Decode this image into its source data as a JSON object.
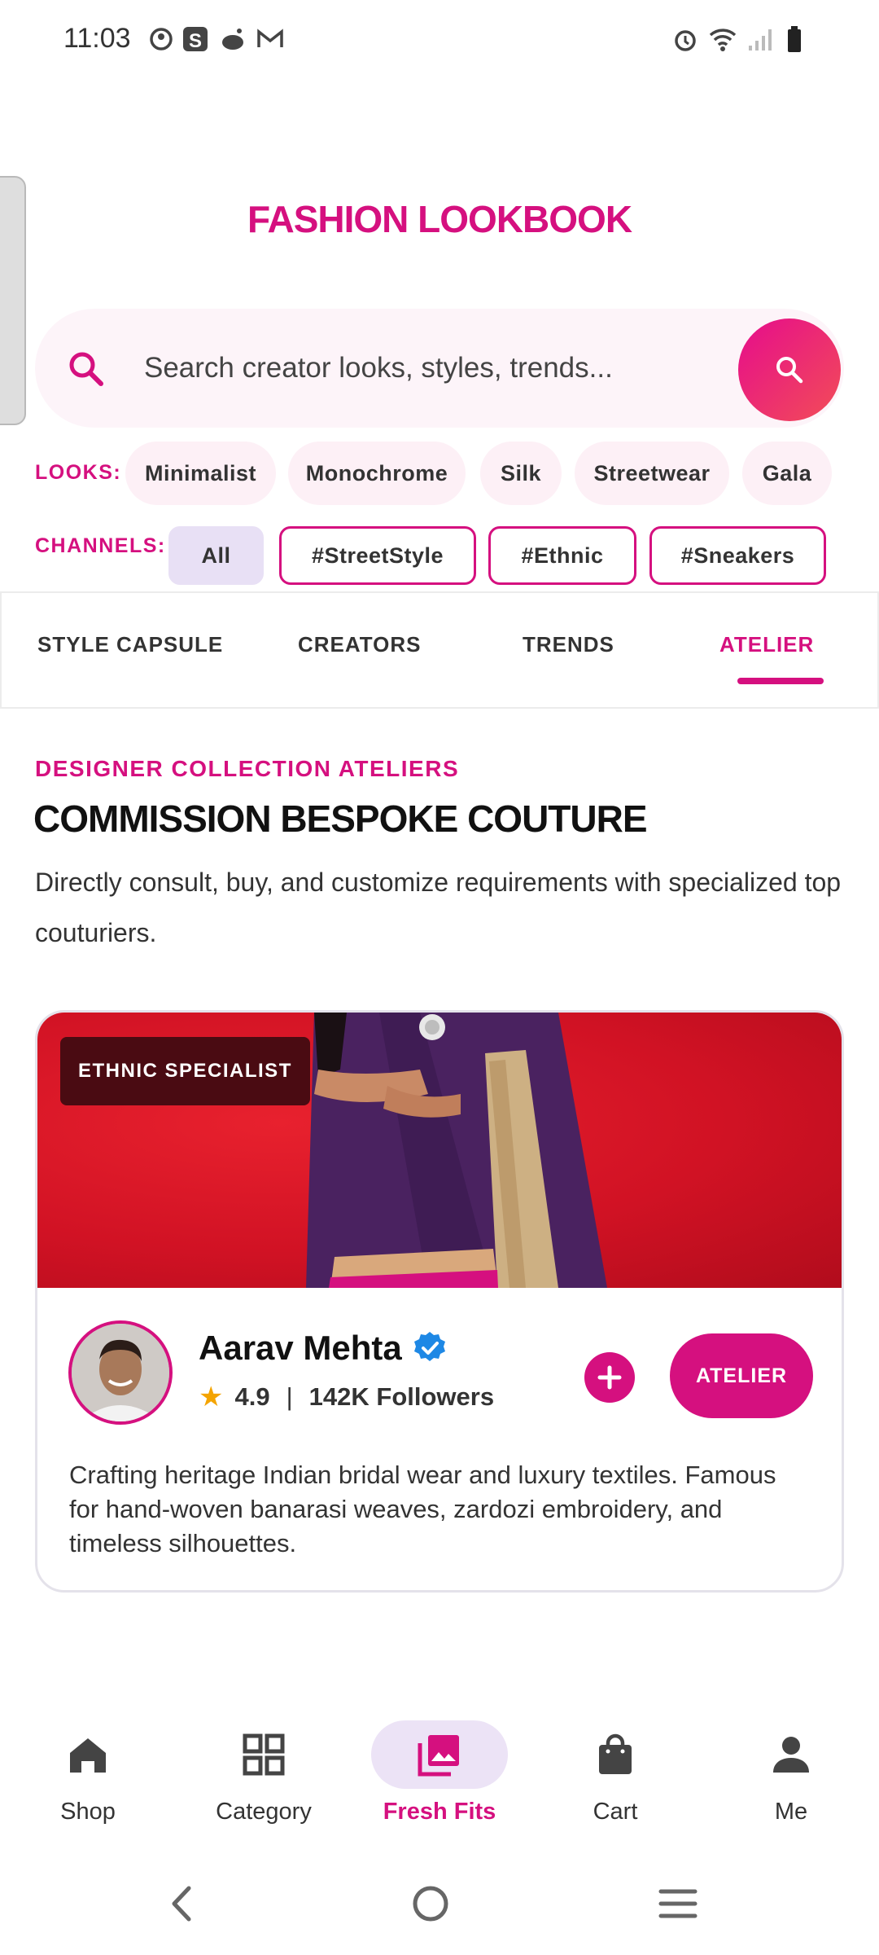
{
  "status_bar": {
    "time": "11:03"
  },
  "app": {
    "title": "FASHION LOOKBOOK"
  },
  "search": {
    "placeholder": "Search creator looks, styles, trends..."
  },
  "looks": {
    "label": "LOOKS:",
    "items": [
      "Minimalist",
      "Monochrome",
      "Silk",
      "Streetwear",
      "Gala"
    ]
  },
  "channels": {
    "label": "CHANNELS:",
    "items": [
      "All",
      "#StreetStyle",
      "#Ethnic",
      "#Sneakers"
    ],
    "selected": "All"
  },
  "tabs": {
    "items": [
      "STYLE CAPSULE",
      "CREATORS",
      "TRENDS",
      "ATELIER"
    ],
    "active": "ATELIER"
  },
  "section": {
    "eyebrow": "DESIGNER COLLECTION ATELIERS",
    "heading": "COMMISSION BESPOKE COUTURE",
    "description": "Directly consult, buy, and customize requirements with specialized top couturiers."
  },
  "card": {
    "badge": "ETHNIC SPECIALIST",
    "name": "Aarav Mehta",
    "rating": "4.9",
    "separator": "|",
    "followers": "142K Followers",
    "atelier_button": "ATELIER",
    "bio": "Crafting heritage Indian bridal wear and luxury textiles. Famous for hand-woven banarasi weaves, zardozi embroidery, and timeless silhouettes."
  },
  "bottom_nav": {
    "items": [
      "Shop",
      "Category",
      "Fresh Fits",
      "Cart",
      "Me"
    ],
    "active": "Fresh Fits"
  },
  "colors": {
    "accent": "#d5107f",
    "hero_background": "#d11224",
    "selected_chip": "#e8e0f5"
  }
}
